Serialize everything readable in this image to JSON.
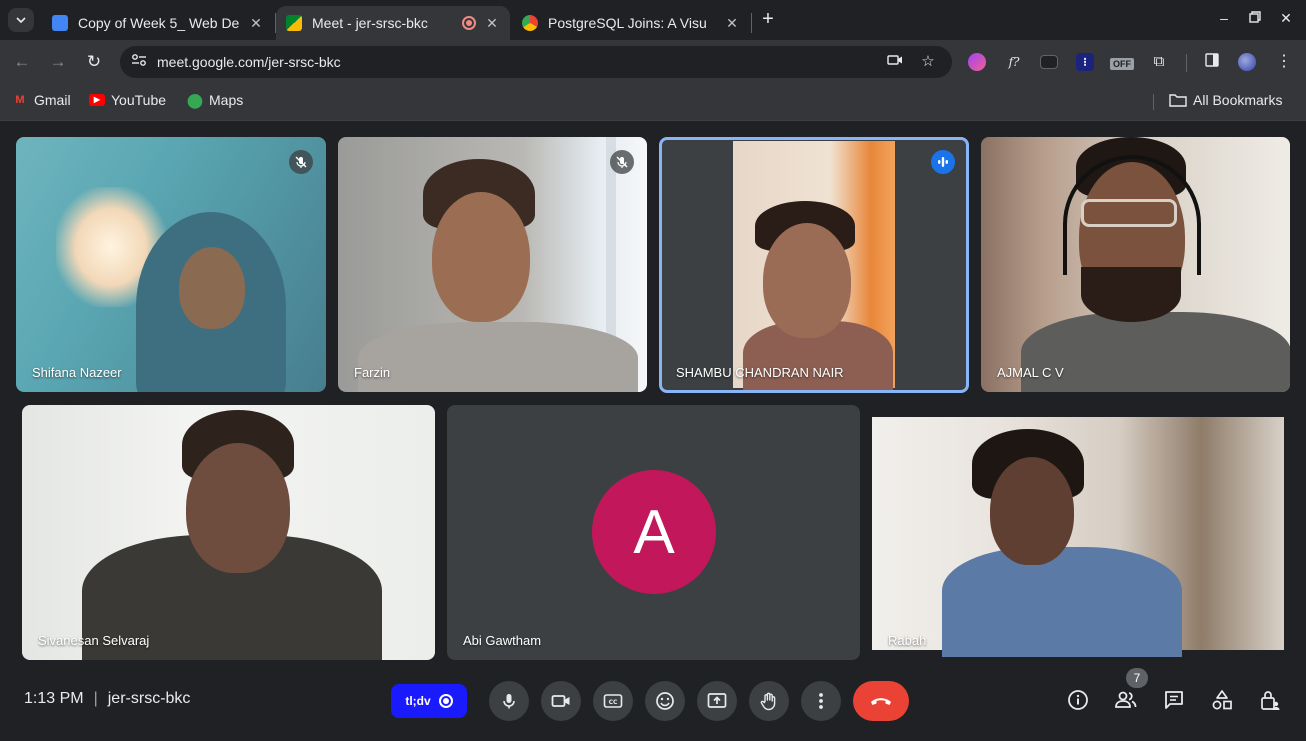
{
  "browser": {
    "tabs": [
      {
        "title": "Copy of Week 5_ Web De",
        "icon": "google-docs-icon",
        "active": false
      },
      {
        "title": "Meet - jer-srsc-bkc",
        "icon": "google-meet-icon",
        "active": true,
        "recording": true
      },
      {
        "title": "PostgreSQL Joins: A Visu",
        "icon": "postgresql-icon",
        "active": false
      }
    ],
    "url": "meet.google.com/jer-srsc-bkc",
    "extension_off_label": "OFF",
    "bookmarks": [
      {
        "label": "Gmail",
        "icon": "gmail-icon"
      },
      {
        "label": "YouTube",
        "icon": "youtube-icon"
      },
      {
        "label": "Maps",
        "icon": "maps-icon"
      }
    ],
    "all_bookmarks": "All Bookmarks"
  },
  "participants": [
    {
      "name": "Shifana Nazeer",
      "muted": true,
      "speaking": false
    },
    {
      "name": "Farzin",
      "muted": true,
      "speaking": false
    },
    {
      "name": "SHAMBU CHANDRAN NAIR",
      "muted": false,
      "speaking": true
    },
    {
      "name": "AJMAL C V",
      "muted": false,
      "speaking": false
    },
    {
      "name": "Sivanesan Selvaraj",
      "muted": false,
      "speaking": false
    },
    {
      "name": "Abi Gawtham",
      "muted": false,
      "speaking": false,
      "avatar_letter": "A",
      "avatar_color": "#c2185b"
    },
    {
      "name": "Rabah",
      "muted": false,
      "speaking": false
    }
  ],
  "meeting": {
    "time": "1:13 PM",
    "separator": "|",
    "code": "jer-srsc-bkc",
    "extension_label": "tl;dv",
    "participant_count": "7"
  },
  "colors": {
    "accent": "#1a73e8",
    "end_call": "#ea4335",
    "speaker_ring": "#8ab4f8"
  }
}
